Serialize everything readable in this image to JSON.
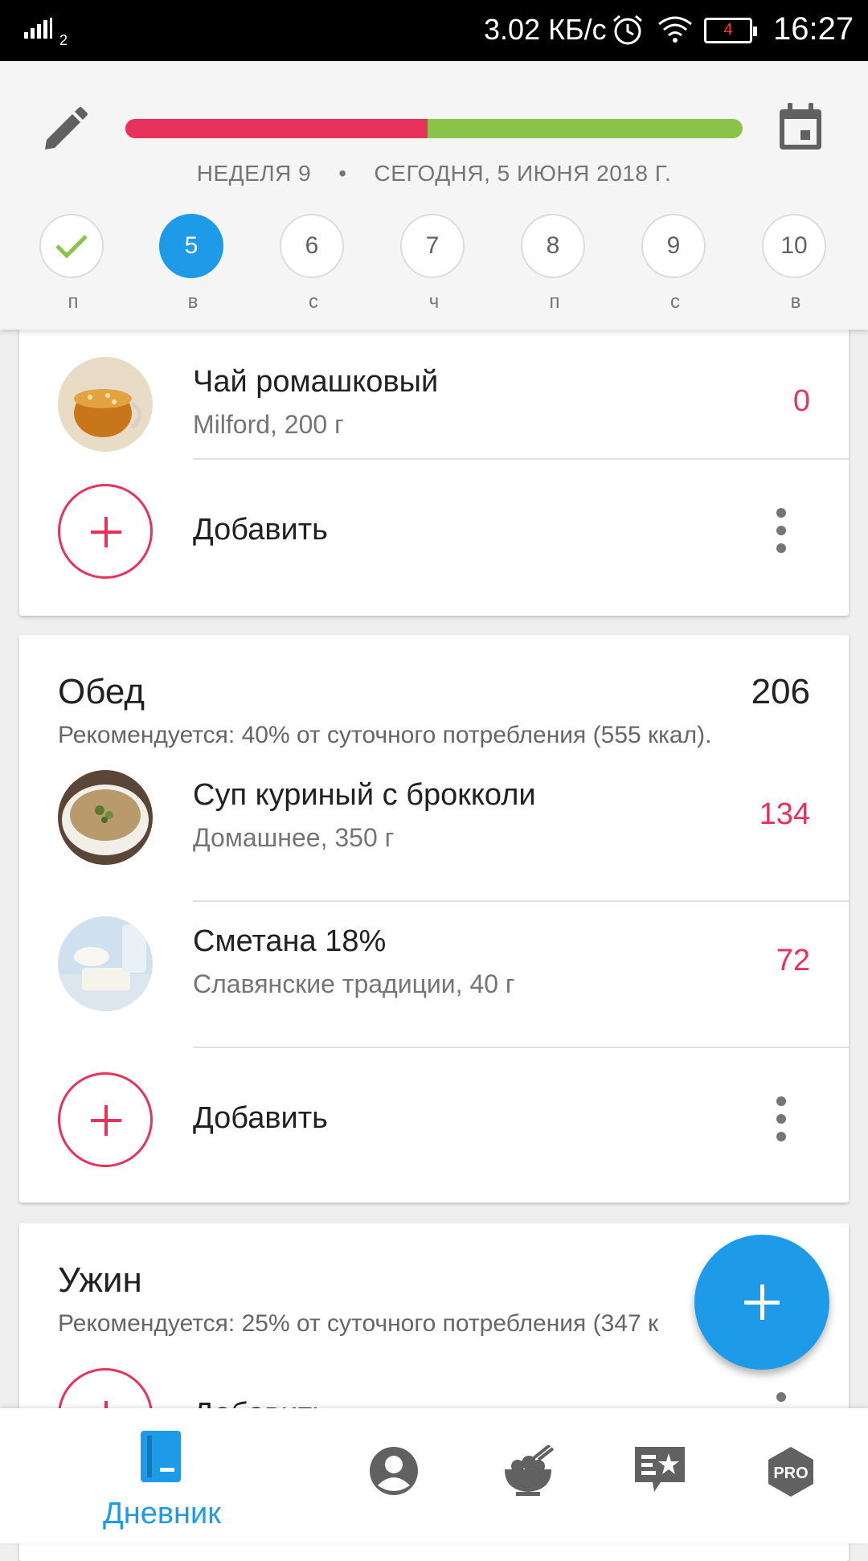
{
  "status_bar": {
    "network_type": "2",
    "speed": "3.02 КБ/с",
    "battery_level": "4",
    "time": "16:27"
  },
  "header": {
    "calories_progress": 0.49,
    "week_label": "НЕДЕЛЯ 9",
    "separator": "•",
    "date_label": "СЕГОДНЯ, 5 ИЮНЯ 2018 Г.",
    "days": [
      {
        "number": "",
        "label": "п",
        "state": "done"
      },
      {
        "number": "5",
        "label": "в",
        "state": "active"
      },
      {
        "number": "6",
        "label": "с",
        "state": "normal"
      },
      {
        "number": "7",
        "label": "ч",
        "state": "normal"
      },
      {
        "number": "8",
        "label": "п",
        "state": "normal"
      },
      {
        "number": "9",
        "label": "с",
        "state": "normal"
      },
      {
        "number": "10",
        "label": "в",
        "state": "normal"
      }
    ]
  },
  "breakfast": {
    "items": [
      {
        "name": "Чай ромашковый",
        "sub": "Milford, 200 г",
        "kcal": "0"
      }
    ],
    "add_label": "Добавить"
  },
  "lunch": {
    "title": "Обед",
    "total": "206",
    "recommendation": "Рекомендуется: 40% от суточного потребления (555 ккал).",
    "items": [
      {
        "name": "Суп куриный с брокколи",
        "sub": "Домашнее, 350 г",
        "kcal": "134"
      },
      {
        "name": "Сметана 18%",
        "sub": "Славянские традиции, 40 г",
        "kcal": "72"
      }
    ],
    "add_label": "Добавить"
  },
  "dinner": {
    "title": "Ужин",
    "recommendation": "Рекомендуется: 25% от суточного потребления (347 к",
    "add_label": "Добавить"
  },
  "bottom_nav": {
    "diary_label": "Дневник",
    "icons": [
      "diary-icon",
      "profile-icon",
      "recipes-icon",
      "articles-icon",
      "pro-icon"
    ]
  },
  "colors": {
    "accent_blue": "#1e9be8",
    "accent_red": "#e8325c",
    "progress_green": "#8bc34a"
  }
}
